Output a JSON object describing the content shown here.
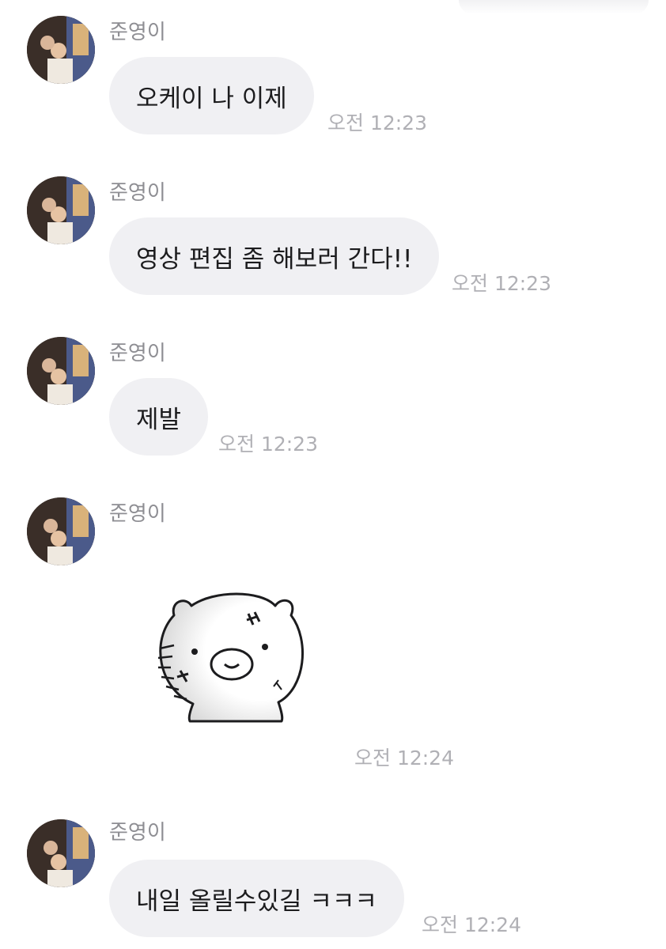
{
  "messages": [
    {
      "sender": "준영이",
      "text": "오케이 나 이제",
      "time": "오전 12:23"
    },
    {
      "sender": "준영이",
      "text": "영상 편집 좀 해보러 간다!!",
      "time": "오전 12:23"
    },
    {
      "sender": "준영이",
      "text": "제발",
      "time": "오전 12:23"
    },
    {
      "sender": "준영이",
      "sticker": "pig-sticker",
      "time": "오전 12:24"
    },
    {
      "sender": "준영이",
      "text": "내일 올릴수있길 ㅋㅋㅋ",
      "time": "오전 12:24"
    }
  ],
  "colors": {
    "bubble": "#f0f0f3",
    "sender": "#8e8e93",
    "time": "#b0b0b5",
    "text": "#1c1c1e"
  }
}
